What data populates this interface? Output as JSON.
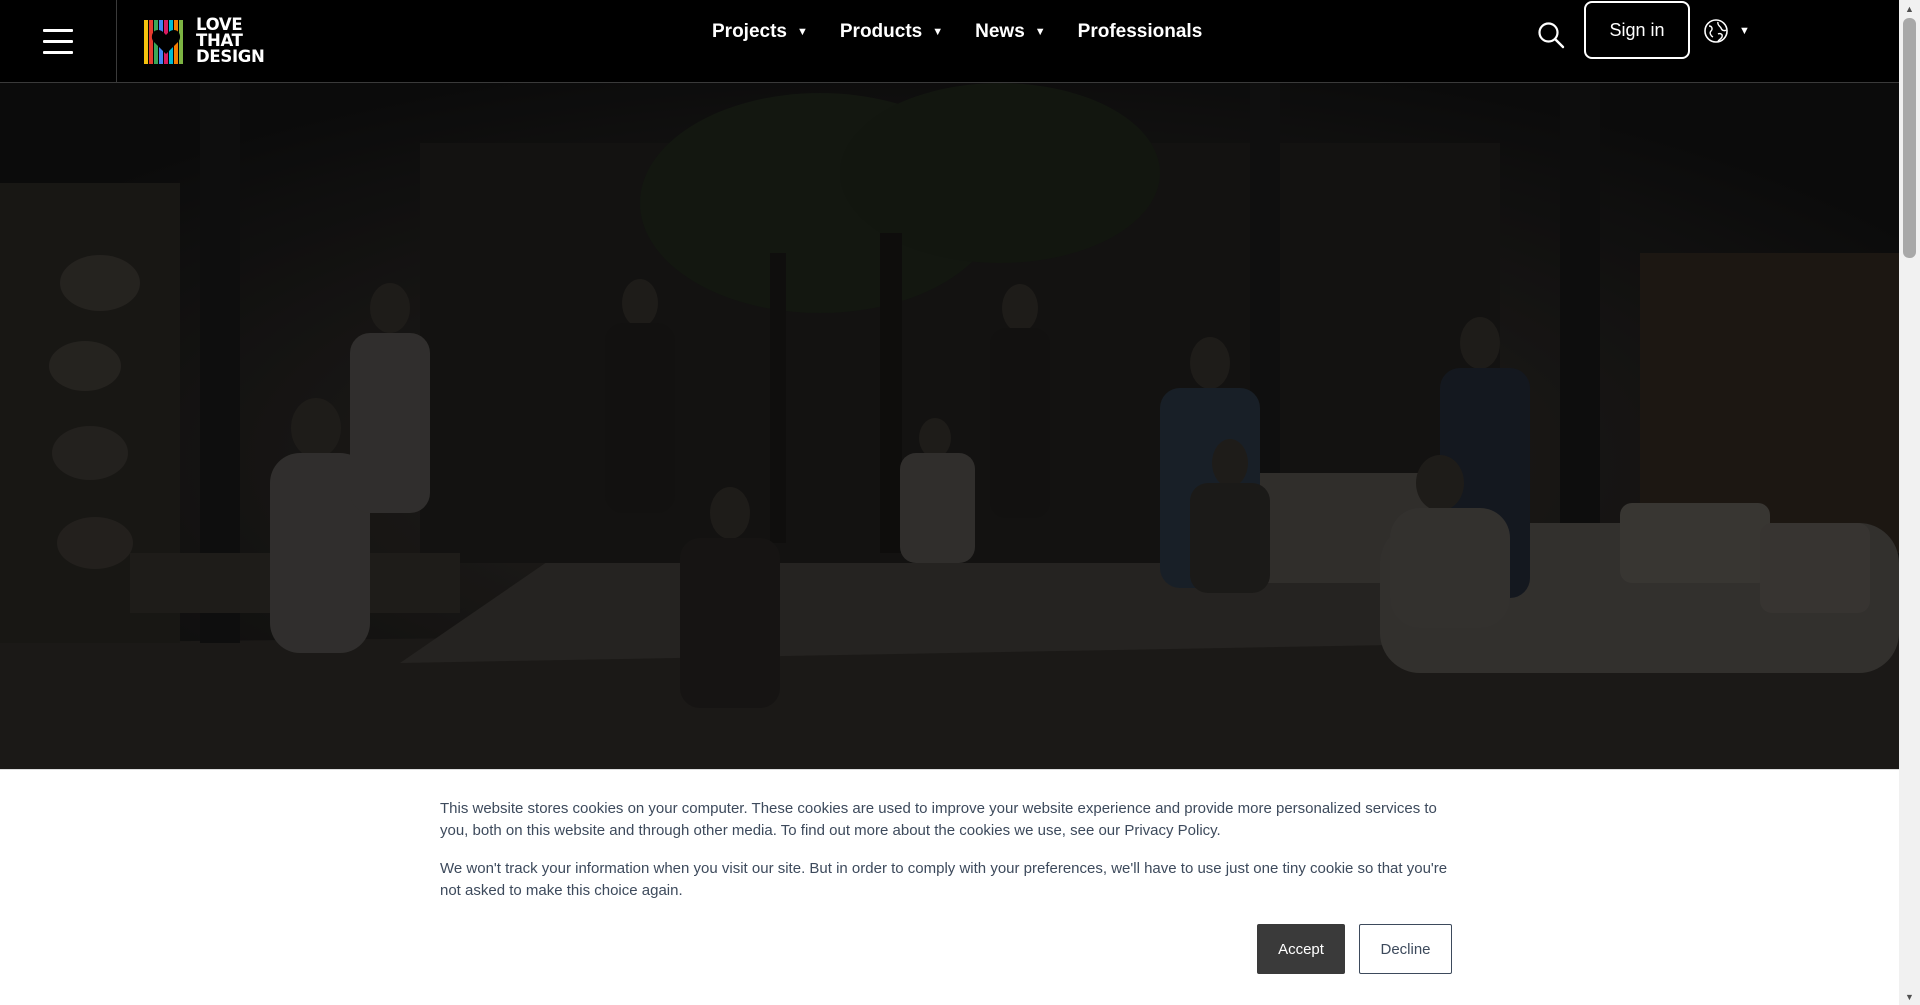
{
  "header": {
    "logo_lines": [
      "LOVE",
      "THAT",
      "DESIGN"
    ],
    "nav": [
      {
        "label": "Projects",
        "has_dropdown": true
      },
      {
        "label": "Products",
        "has_dropdown": true
      },
      {
        "label": "News",
        "has_dropdown": true
      },
      {
        "label": "Professionals",
        "has_dropdown": false
      }
    ],
    "signin_label": "Sign in",
    "icons": {
      "menu": "hamburger-menu-icon",
      "search": "search-icon",
      "language": "globe-icon"
    }
  },
  "hero": {
    "image": "dimmed photograph of a group of people posing in an indoor showroom courtyard with trees and furniture"
  },
  "cookie_banner": {
    "paragraph_1": "This website stores cookies on your computer. These cookies are used to improve your website experience and provide more personalized services to you, both on this website and through other media. To find out more about the cookies we use, see our Privacy Policy.",
    "paragraph_2": "We won't track your information when you visit our site. But in order to comply with your preferences, we'll have to use just one tiny cookie so that you're not asked to make this choice again.",
    "accept_label": "Accept",
    "decline_label": "Decline"
  },
  "colors": {
    "header_bg": "#000000",
    "cookie_text": "#3d4a5c",
    "accept_bg": "#3a3a3a"
  }
}
